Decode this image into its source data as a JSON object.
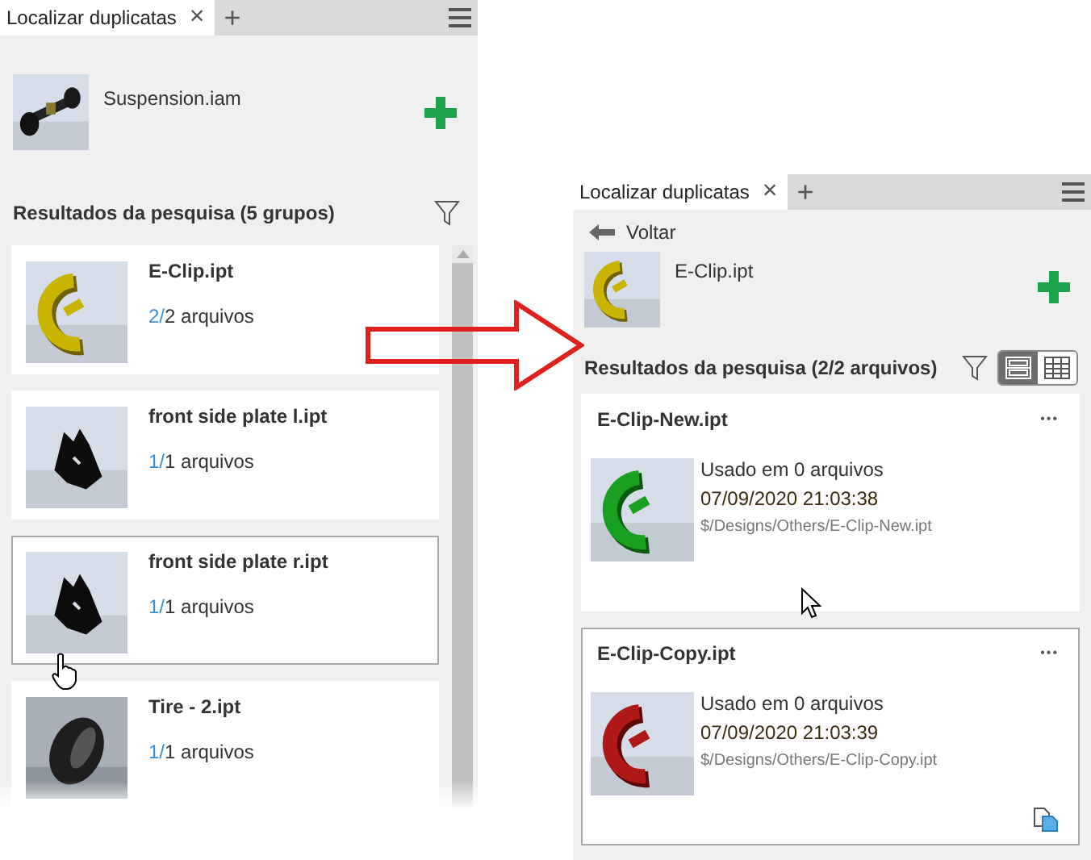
{
  "panels": [
    {
      "tab": {
        "label": "Localizar duplicatas",
        "close": "×",
        "add": "+"
      },
      "source": {
        "name": "Suspension.iam"
      },
      "results_title": "Resultados da pesquisa (5 grupos)",
      "groups": [
        {
          "title": "E-Clip.ipt",
          "count_highlight": "2/",
          "count_text": "2 arquivos",
          "highlighted": false
        },
        {
          "title": "front side plate l.ipt",
          "count_highlight": "1/",
          "count_text": "1 arquivos",
          "highlighted": false
        },
        {
          "title": "front side plate r.ipt",
          "count_highlight": "1/",
          "count_text": "1 arquivos",
          "highlighted": true
        },
        {
          "title": "Tire - 2.ipt",
          "count_highlight": "1/",
          "count_text": "1 arquivos",
          "highlighted": false
        }
      ]
    },
    {
      "tab": {
        "label": "Localizar duplicatas",
        "close": "×",
        "add": "+"
      },
      "back": "Voltar",
      "source": {
        "name": "E-Clip.ipt"
      },
      "results_title": "Resultados da pesquisa (2/2 arquivos)",
      "views": [
        {
          "kind": "list",
          "selected": true
        },
        {
          "kind": "grid",
          "selected": false
        }
      ],
      "files": [
        {
          "title": "E-Clip-New.ipt",
          "menu": "•••",
          "usage": "Usado em 0 arquivos",
          "date": "07/09/2020 21:03:38",
          "path": "$/Designs/Others/E-Clip-New.ipt",
          "highlighted": false,
          "copy_badge": false
        },
        {
          "title": "E-Clip-Copy.ipt",
          "menu": "•••",
          "usage": "Usado em 0 arquivos",
          "date": "07/09/2020 21:03:39",
          "path": "$/Designs/Others/E-Clip-Copy.ipt",
          "highlighted": true,
          "copy_badge": true
        }
      ]
    }
  ]
}
